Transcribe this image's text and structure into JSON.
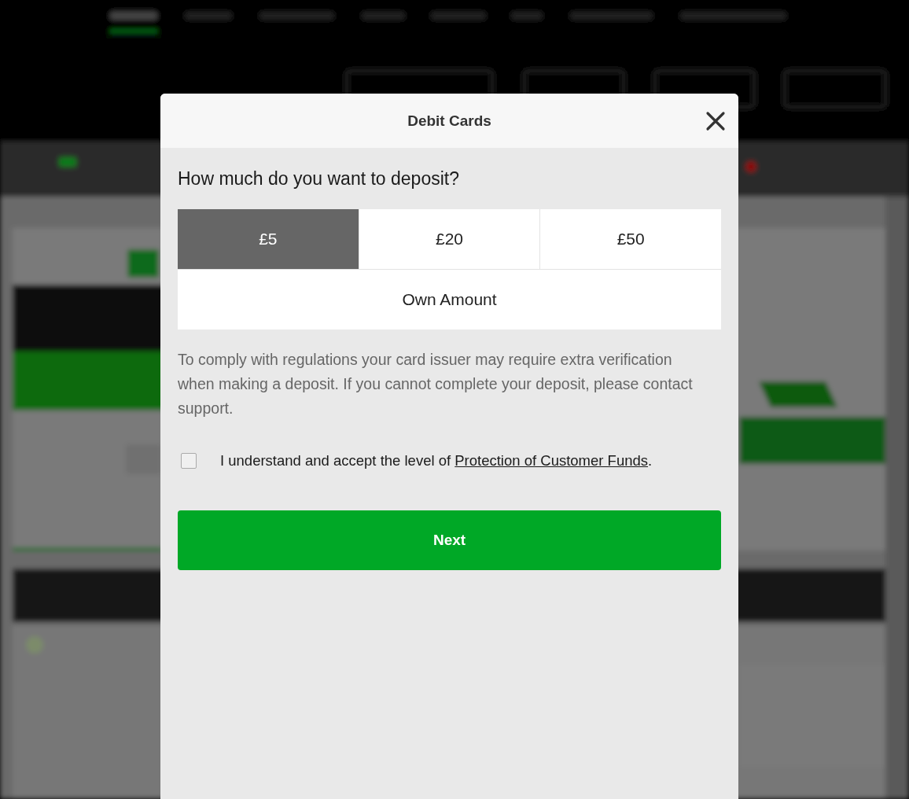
{
  "dialog": {
    "title": "Debit Cards",
    "question": "How much do you want to deposit?",
    "amount_options": [
      {
        "label": "£5",
        "kind": "preset",
        "selected": true
      },
      {
        "label": "£20",
        "kind": "preset",
        "selected": false
      },
      {
        "label": "£50",
        "kind": "preset",
        "selected": false
      },
      {
        "label": "Own Amount",
        "kind": "custom",
        "selected": false
      }
    ],
    "notice": "To comply with regulations your card issuer may require extra verification when making a deposit. If you cannot complete your deposit, please contact support.",
    "consent": {
      "checked": false,
      "text_before": "I understand and accept the level of ",
      "link": "Protection of Customer Funds",
      "text_after": "."
    },
    "next_button": "Next"
  }
}
